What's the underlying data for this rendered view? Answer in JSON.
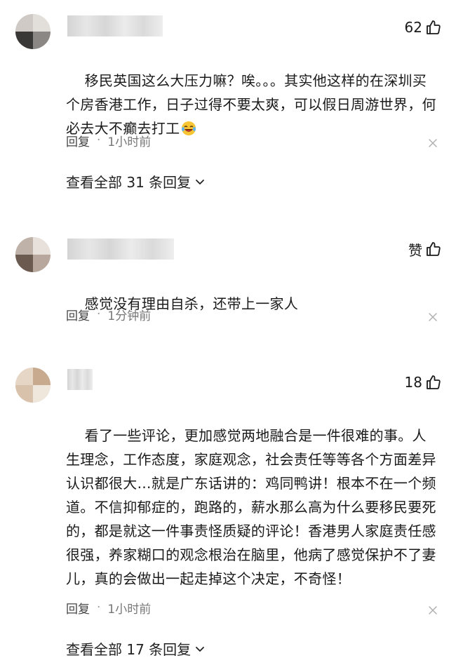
{
  "comments": [
    {
      "like_label": "62",
      "text_main": "移民英国这么大压力嘛？唉。。。其实他这样的在深圳买个房香港工作，日子过得不要太爽，可以假日周游世界，何必去大不癫去打工",
      "emoji": "laugh-cry-emoji",
      "reply_label": "回复",
      "separator": "·",
      "time": "1小时前",
      "view_all": "查看全部 31 条回复"
    },
    {
      "like_label": "赞",
      "text_main": "感觉没有理由自杀，还带上一家人",
      "reply_label": "回复",
      "separator": "·",
      "time": "1分钟前"
    },
    {
      "like_label": "18",
      "text_main": "看了一些评论，更加感觉两地融合是一件很难的事。人生理念，工作态度，家庭观念，社会责任等等各个方面差异认识都很大…就是广东话讲的：鸡同鸭讲！根本不在一个频道。不信抑郁症的，跑路的，薪水那么高为什么要移民要死的，都是就这一件事责怪质疑的评论！香港男人家庭责任感很强，养家糊口的观念根治在脑里，他病了感觉保护不了妻儿，真的会做出一起走掉这个决定，不奇怪！",
      "reply_label": "回复",
      "separator": "·",
      "time": "1小时前",
      "view_all": "查看全部 17 条回复"
    }
  ],
  "icons": {
    "like": "thumbs-up-icon",
    "close": "close-icon",
    "chevron": "chevron-down-icon"
  },
  "colors": {
    "text": "#1a1a1a",
    "meta": "#777777",
    "background": "#ffffff"
  }
}
